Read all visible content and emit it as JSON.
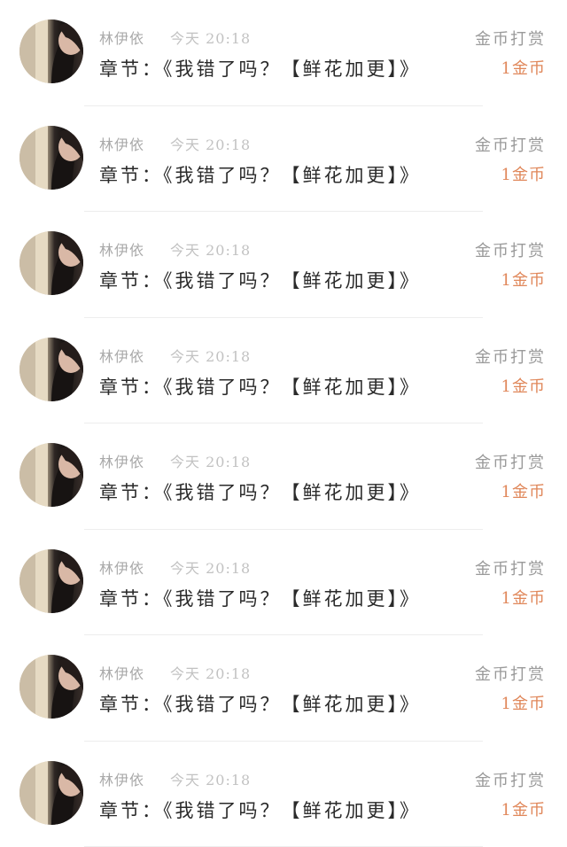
{
  "colors": {
    "username": "#a9a9a9",
    "timestamp": "#c2c2c2",
    "chapter_text": "#2a2a2a",
    "tip_label": "#9a9a9a",
    "tip_amount": "#e0875a"
  },
  "icons": {
    "avatar": "user-avatar-photo"
  },
  "items": [
    {
      "username": "林伊依",
      "time": "今天 20:18",
      "chapter": "章节：《我错了吗？【鲜花加更】》",
      "tip_label": "金币打赏",
      "tip_amount": "1金币"
    },
    {
      "username": "林伊依",
      "time": "今天 20:18",
      "chapter": "章节：《我错了吗？【鲜花加更】》",
      "tip_label": "金币打赏",
      "tip_amount": "1金币"
    },
    {
      "username": "林伊依",
      "time": "今天 20:18",
      "chapter": "章节：《我错了吗？【鲜花加更】》",
      "tip_label": "金币打赏",
      "tip_amount": "1金币"
    },
    {
      "username": "林伊依",
      "time": "今天 20:18",
      "chapter": "章节：《我错了吗？【鲜花加更】》",
      "tip_label": "金币打赏",
      "tip_amount": "1金币"
    },
    {
      "username": "林伊依",
      "time": "今天 20:18",
      "chapter": "章节：《我错了吗？【鲜花加更】》",
      "tip_label": "金币打赏",
      "tip_amount": "1金币"
    },
    {
      "username": "林伊依",
      "time": "今天 20:18",
      "chapter": "章节：《我错了吗？【鲜花加更】》",
      "tip_label": "金币打赏",
      "tip_amount": "1金币"
    },
    {
      "username": "林伊依",
      "time": "今天 20:18",
      "chapter": "章节：《我错了吗？【鲜花加更】》",
      "tip_label": "金币打赏",
      "tip_amount": "1金币"
    },
    {
      "username": "林伊依",
      "time": "今天 20:18",
      "chapter": "章节：《我错了吗？【鲜花加更】》",
      "tip_label": "金币打赏",
      "tip_amount": "1金币"
    }
  ]
}
